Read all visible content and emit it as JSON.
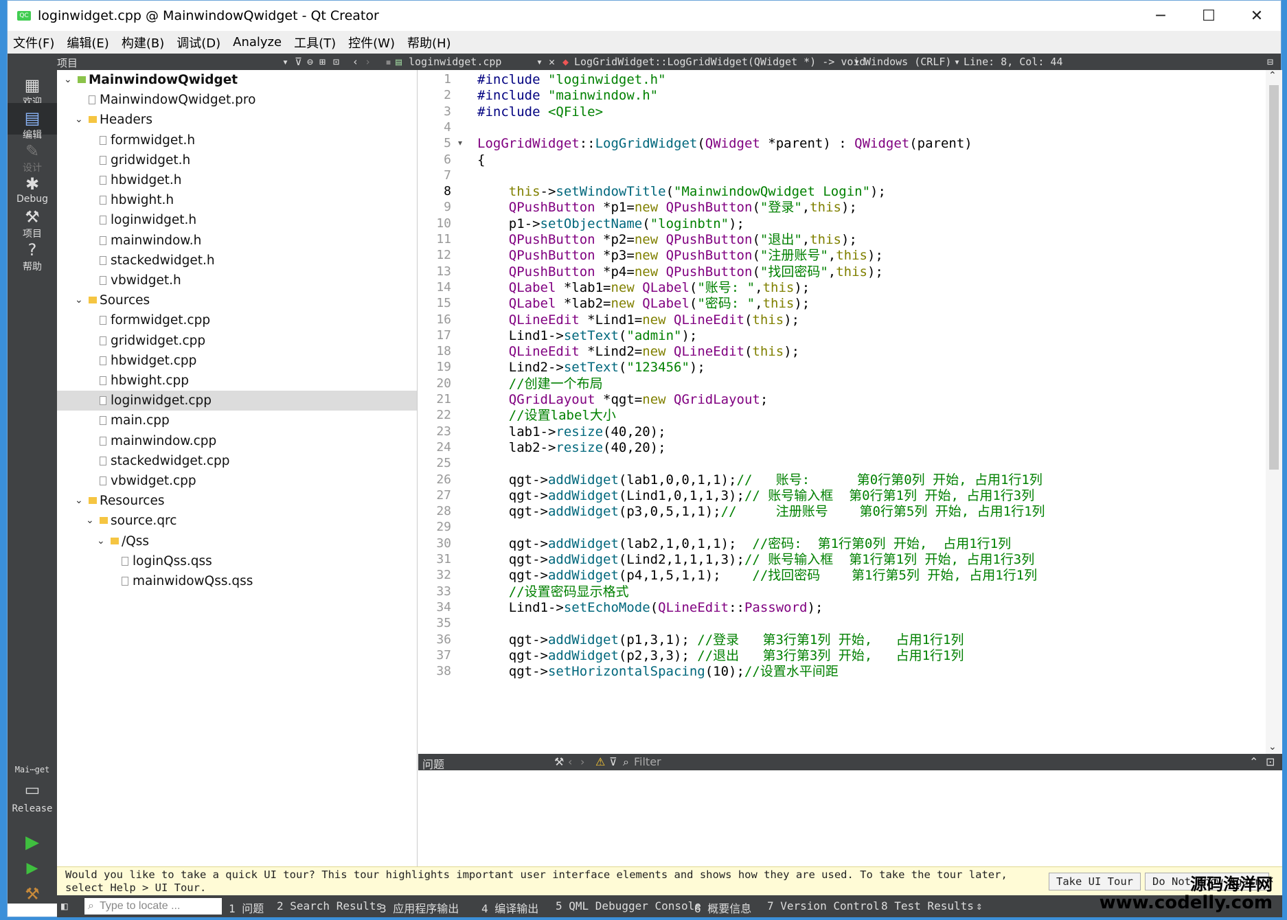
{
  "window": {
    "title": "loginwidget.cpp @ MainwindowQwidget - Qt Creator",
    "app_icon": "qt-creator-icon",
    "minimize": "─",
    "maximize": "☐",
    "close": "✕"
  },
  "menu": [
    "文件(F)",
    "编辑(E)",
    "构建(B)",
    "调试(D)",
    "Analyze",
    "工具(T)",
    "控件(W)",
    "帮助(H)"
  ],
  "toolbar": {
    "panel_title": "项目",
    "file_combo": "loginwidget.cpp",
    "symbol_combo": "LogGridWidget::LogGridWidget(QWidget *) -> void",
    "line_ending": "Windows (CRLF)",
    "position": "Line: 8, Col: 44"
  },
  "modes": [
    {
      "label": "欢迎",
      "icon": "grid-icon"
    },
    {
      "label": "编辑",
      "icon": "edit-icon"
    },
    {
      "label": "设计",
      "icon": "pencil-icon"
    },
    {
      "label": "Debug",
      "icon": "bug-icon"
    },
    {
      "label": "项目",
      "icon": "wrench-icon"
    },
    {
      "label": "帮助",
      "icon": "help-icon"
    }
  ],
  "kit": {
    "project": "Mai⋯get",
    "config": "Release"
  },
  "tree": [
    {
      "label": "MainwindowQwidget",
      "level": 0,
      "type": "project",
      "expanded": true
    },
    {
      "label": "MainwindowQwidget.pro",
      "level": 1,
      "type": "file"
    },
    {
      "label": "Headers",
      "level": 1,
      "type": "folder",
      "expanded": true
    },
    {
      "label": "formwidget.h",
      "level": 2,
      "type": "file"
    },
    {
      "label": "gridwidget.h",
      "level": 2,
      "type": "file"
    },
    {
      "label": "hbwidget.h",
      "level": 2,
      "type": "file"
    },
    {
      "label": "hbwight.h",
      "level": 2,
      "type": "file"
    },
    {
      "label": "loginwidget.h",
      "level": 2,
      "type": "file"
    },
    {
      "label": "mainwindow.h",
      "level": 2,
      "type": "file"
    },
    {
      "label": "stackedwidget.h",
      "level": 2,
      "type": "file"
    },
    {
      "label": "vbwidget.h",
      "level": 2,
      "type": "file"
    },
    {
      "label": "Sources",
      "level": 1,
      "type": "folder",
      "expanded": true
    },
    {
      "label": "formwidget.cpp",
      "level": 2,
      "type": "file"
    },
    {
      "label": "gridwidget.cpp",
      "level": 2,
      "type": "file"
    },
    {
      "label": "hbwidget.cpp",
      "level": 2,
      "type": "file"
    },
    {
      "label": "hbwight.cpp",
      "level": 2,
      "type": "file"
    },
    {
      "label": "loginwidget.cpp",
      "level": 2,
      "type": "file",
      "selected": true
    },
    {
      "label": "main.cpp",
      "level": 2,
      "type": "file"
    },
    {
      "label": "mainwindow.cpp",
      "level": 2,
      "type": "file"
    },
    {
      "label": "stackedwidget.cpp",
      "level": 2,
      "type": "file"
    },
    {
      "label": "vbwidget.cpp",
      "level": 2,
      "type": "file"
    },
    {
      "label": "Resources",
      "level": 1,
      "type": "folder",
      "expanded": true
    },
    {
      "label": "source.qrc",
      "level": 2,
      "type": "folder",
      "expanded": true
    },
    {
      "label": "/Qss",
      "level": 3,
      "type": "folder",
      "expanded": true
    },
    {
      "label": "loginQss.qss",
      "level": 4,
      "type": "file"
    },
    {
      "label": "mainwidowQss.qss",
      "level": 4,
      "type": "file"
    }
  ],
  "code_lines": [
    [
      [
        "pp",
        "#include "
      ],
      [
        "inc",
        "\"loginwidget.h\""
      ]
    ],
    [
      [
        "pp",
        "#include "
      ],
      [
        "inc",
        "\"mainwindow.h\""
      ]
    ],
    [
      [
        "pp",
        "#include "
      ],
      [
        "inc",
        "<QFile>"
      ]
    ],
    [],
    [
      [
        "ty",
        "LogGridWidget"
      ],
      [
        "",
        "::"
      ],
      [
        "fn",
        "LogGridWidget"
      ],
      [
        "",
        "("
      ],
      [
        "ty",
        "QWidget"
      ],
      [
        "",
        " *parent) : "
      ],
      [
        "ty",
        "QWidget"
      ],
      [
        "",
        "(parent)"
      ]
    ],
    [
      [
        "",
        "{"
      ]
    ],
    [],
    [
      [
        "",
        "    "
      ],
      [
        "kw",
        "this"
      ],
      [
        "",
        "->"
      ],
      [
        "fn",
        "setWindowTitle"
      ],
      [
        "",
        "("
      ],
      [
        "st",
        "\"MainwindowQwidget Login\""
      ],
      [
        "",
        ");"
      ]
    ],
    [
      [
        "",
        "    "
      ],
      [
        "ty",
        "QPushButton"
      ],
      [
        "",
        " *p1="
      ],
      [
        "kw",
        "new"
      ],
      [
        "",
        " "
      ],
      [
        "ty",
        "QPushButton"
      ],
      [
        "",
        "("
      ],
      [
        "st",
        "\"登录\""
      ],
      [
        "",
        ","
      ],
      [
        "kw",
        "this"
      ],
      [
        "",
        ");"
      ]
    ],
    [
      [
        "",
        "    p1->"
      ],
      [
        "fn",
        "setObjectName"
      ],
      [
        "",
        "("
      ],
      [
        "st",
        "\"loginbtn\""
      ],
      [
        "",
        ");"
      ]
    ],
    [
      [
        "",
        "    "
      ],
      [
        "ty",
        "QPushButton"
      ],
      [
        "",
        " *p2="
      ],
      [
        "kw",
        "new"
      ],
      [
        "",
        " "
      ],
      [
        "ty",
        "QPushButton"
      ],
      [
        "",
        "("
      ],
      [
        "st",
        "\"退出\""
      ],
      [
        "",
        ","
      ],
      [
        "kw",
        "this"
      ],
      [
        "",
        ");"
      ]
    ],
    [
      [
        "",
        "    "
      ],
      [
        "ty",
        "QPushButton"
      ],
      [
        "",
        " *p3="
      ],
      [
        "kw",
        "new"
      ],
      [
        "",
        " "
      ],
      [
        "ty",
        "QPushButton"
      ],
      [
        "",
        "("
      ],
      [
        "st",
        "\"注册账号\""
      ],
      [
        "",
        ","
      ],
      [
        "kw",
        "this"
      ],
      [
        "",
        ");"
      ]
    ],
    [
      [
        "",
        "    "
      ],
      [
        "ty",
        "QPushButton"
      ],
      [
        "",
        " *p4="
      ],
      [
        "kw",
        "new"
      ],
      [
        "",
        " "
      ],
      [
        "ty",
        "QPushButton"
      ],
      [
        "",
        "("
      ],
      [
        "st",
        "\"找回密码\""
      ],
      [
        "",
        ","
      ],
      [
        "kw",
        "this"
      ],
      [
        "",
        ");"
      ]
    ],
    [
      [
        "",
        "    "
      ],
      [
        "ty",
        "QLabel"
      ],
      [
        "",
        " *lab1="
      ],
      [
        "kw",
        "new"
      ],
      [
        "",
        " "
      ],
      [
        "ty",
        "QLabel"
      ],
      [
        "",
        "("
      ],
      [
        "st",
        "\"账号: \""
      ],
      [
        "",
        ","
      ],
      [
        "kw",
        "this"
      ],
      [
        "",
        ");"
      ]
    ],
    [
      [
        "",
        "    "
      ],
      [
        "ty",
        "QLabel"
      ],
      [
        "",
        " *lab2="
      ],
      [
        "kw",
        "new"
      ],
      [
        "",
        " "
      ],
      [
        "ty",
        "QLabel"
      ],
      [
        "",
        "("
      ],
      [
        "st",
        "\"密码: \""
      ],
      [
        "",
        ","
      ],
      [
        "kw",
        "this"
      ],
      [
        "",
        ");"
      ]
    ],
    [
      [
        "",
        "    "
      ],
      [
        "ty",
        "QLineEdit"
      ],
      [
        "",
        " *Lind1="
      ],
      [
        "kw",
        "new"
      ],
      [
        "",
        " "
      ],
      [
        "ty",
        "QLineEdit"
      ],
      [
        "",
        "("
      ],
      [
        "kw",
        "this"
      ],
      [
        "",
        ");"
      ]
    ],
    [
      [
        "",
        "    Lind1->"
      ],
      [
        "fn",
        "setText"
      ],
      [
        "",
        "("
      ],
      [
        "st",
        "\"admin\""
      ],
      [
        "",
        ");"
      ]
    ],
    [
      [
        "",
        "    "
      ],
      [
        "ty",
        "QLineEdit"
      ],
      [
        "",
        " *Lind2="
      ],
      [
        "kw",
        "new"
      ],
      [
        "",
        " "
      ],
      [
        "ty",
        "QLineEdit"
      ],
      [
        "",
        "("
      ],
      [
        "kw",
        "this"
      ],
      [
        "",
        ");"
      ]
    ],
    [
      [
        "",
        "    Lind2->"
      ],
      [
        "fn",
        "setText"
      ],
      [
        "",
        "("
      ],
      [
        "st",
        "\"123456\""
      ],
      [
        "",
        ");"
      ]
    ],
    [
      [
        "",
        "    "
      ],
      [
        "cm",
        "//创建一个布局"
      ]
    ],
    [
      [
        "",
        "    "
      ],
      [
        "ty",
        "QGridLayout"
      ],
      [
        "",
        " *qgt="
      ],
      [
        "kw",
        "new"
      ],
      [
        "",
        " "
      ],
      [
        "ty",
        "QGridLayout"
      ],
      [
        "",
        ";"
      ]
    ],
    [
      [
        "",
        "    "
      ],
      [
        "cm",
        "//设置label大小"
      ]
    ],
    [
      [
        "",
        "    lab1->"
      ],
      [
        "fn",
        "resize"
      ],
      [
        "",
        "(40,20);"
      ]
    ],
    [
      [
        "",
        "    lab2->"
      ],
      [
        "fn",
        "resize"
      ],
      [
        "",
        "(40,20);"
      ]
    ],
    [],
    [
      [
        "",
        "    qgt->"
      ],
      [
        "fn",
        "addWidget"
      ],
      [
        "",
        "(lab1,0,0,1,1);"
      ],
      [
        "cm",
        "//   账号:      第0行第0列 开始, 占用1行1列"
      ]
    ],
    [
      [
        "",
        "    qgt->"
      ],
      [
        "fn",
        "addWidget"
      ],
      [
        "",
        "(Lind1,0,1,1,3);"
      ],
      [
        "cm",
        "// 账号输入框  第0行第1列 开始, 占用1行3列"
      ]
    ],
    [
      [
        "",
        "    qgt->"
      ],
      [
        "fn",
        "addWidget"
      ],
      [
        "",
        "(p3,0,5,1,1);"
      ],
      [
        "cm",
        "//     注册账号    第0行第5列 开始, 占用1行1列"
      ]
    ],
    [],
    [
      [
        "",
        "    qgt->"
      ],
      [
        "fn",
        "addWidget"
      ],
      [
        "",
        "(lab2,1,0,1,1);  "
      ],
      [
        "cm",
        "//密码:  第1行第0列 开始,  占用1行1列"
      ]
    ],
    [
      [
        "",
        "    qgt->"
      ],
      [
        "fn",
        "addWidget"
      ],
      [
        "",
        "(Lind2,1,1,1,3);"
      ],
      [
        "cm",
        "// 账号输入框  第1行第1列 开始, 占用1行3列"
      ]
    ],
    [
      [
        "",
        "    qgt->"
      ],
      [
        "fn",
        "addWidget"
      ],
      [
        "",
        "(p4,1,5,1,1);    "
      ],
      [
        "cm",
        "//找回密码    第1行第5列 开始, 占用1行1列"
      ]
    ],
    [
      [
        "",
        "    "
      ],
      [
        "cm",
        "//设置密码显示格式"
      ]
    ],
    [
      [
        "",
        "    Lind1->"
      ],
      [
        "fn",
        "setEchoMode"
      ],
      [
        "",
        "("
      ],
      [
        "ty",
        "QLineEdit"
      ],
      [
        "",
        "::"
      ],
      [
        "ty",
        "Password"
      ],
      [
        "",
        ");"
      ]
    ],
    [],
    [
      [
        "",
        "    qgt->"
      ],
      [
        "fn",
        "addWidget"
      ],
      [
        "",
        "(p1,3,1); "
      ],
      [
        "cm",
        "//登录   第3行第1列 开始,   占用1行1列"
      ]
    ],
    [
      [
        "",
        "    qgt->"
      ],
      [
        "fn",
        "addWidget"
      ],
      [
        "",
        "(p2,3,3); "
      ],
      [
        "cm",
        "//退出   第3行第3列 开始,   占用1行1列"
      ]
    ],
    [
      [
        "",
        "    qgt->"
      ],
      [
        "fn",
        "setHorizontalSpacing"
      ],
      [
        "",
        "(10);"
      ],
      [
        "cm",
        "//设置水平间距"
      ]
    ]
  ],
  "issues": {
    "title": "问题",
    "filter_placeholder": "Filter"
  },
  "tour": {
    "message": "Would you like to take a quick UI tour? This tour highlights important user interface elements and shows how they are used. To take the tour later, select Help > UI Tour.",
    "take_tour": "Take UI Tour",
    "dont_show": "Do Not Show Again",
    "close": "✕"
  },
  "status": {
    "locate_placeholder": "Type to locate ...",
    "panes": [
      "1 问题",
      "2 Search Results",
      "3 应用程序输出",
      "4 编译输出",
      "5 QML Debugger Console",
      "6 概要信息",
      "7 Version Control",
      "8 Test Results"
    ]
  },
  "watermark": {
    "line1": "源码海洋网",
    "line2": "www.codelly.com"
  }
}
